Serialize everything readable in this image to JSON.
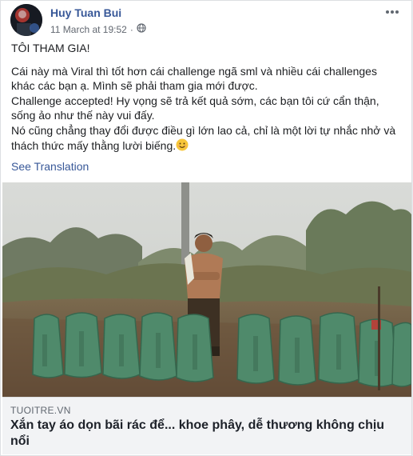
{
  "post": {
    "author": "Huy Tuan Bui",
    "timestamp": "11 March at 19:52",
    "privacy_dot": "·",
    "privacy_icon": "globe-icon",
    "more_icon": "ellipsis-icon",
    "paragraphs": [
      "TÔI THAM GIA!",
      "Cái này mà Viral thì tốt hơn cái challenge ngã sml và nhiều cái challenges khác các bạn ạ. Mình sẽ phải tham gia mới được.",
      "Challenge accepted! Hy vọng sẽ trả kết quả sớm, các bạn tôi cứ cẩn thận, sống ảo như thế này vui đấy.",
      "Nó cũng chẳng thay đổi được điều gì lớn lao cả, chỉ là một lời tự nhắc nhở và thách thức mấy thằng lười biếng."
    ],
    "emoji_icon": "smiling-face-emoji",
    "see_translation": "See Translation"
  },
  "link_preview": {
    "source": "TUOITRE.VN",
    "headline": "Xắn tay áo dọn bãi rác để... khoe phây, dễ thương không chịu nổi"
  },
  "colors": {
    "link_blue": "#385898",
    "page_bg": "#e9ebee",
    "link_box_bg": "#f2f3f5"
  }
}
